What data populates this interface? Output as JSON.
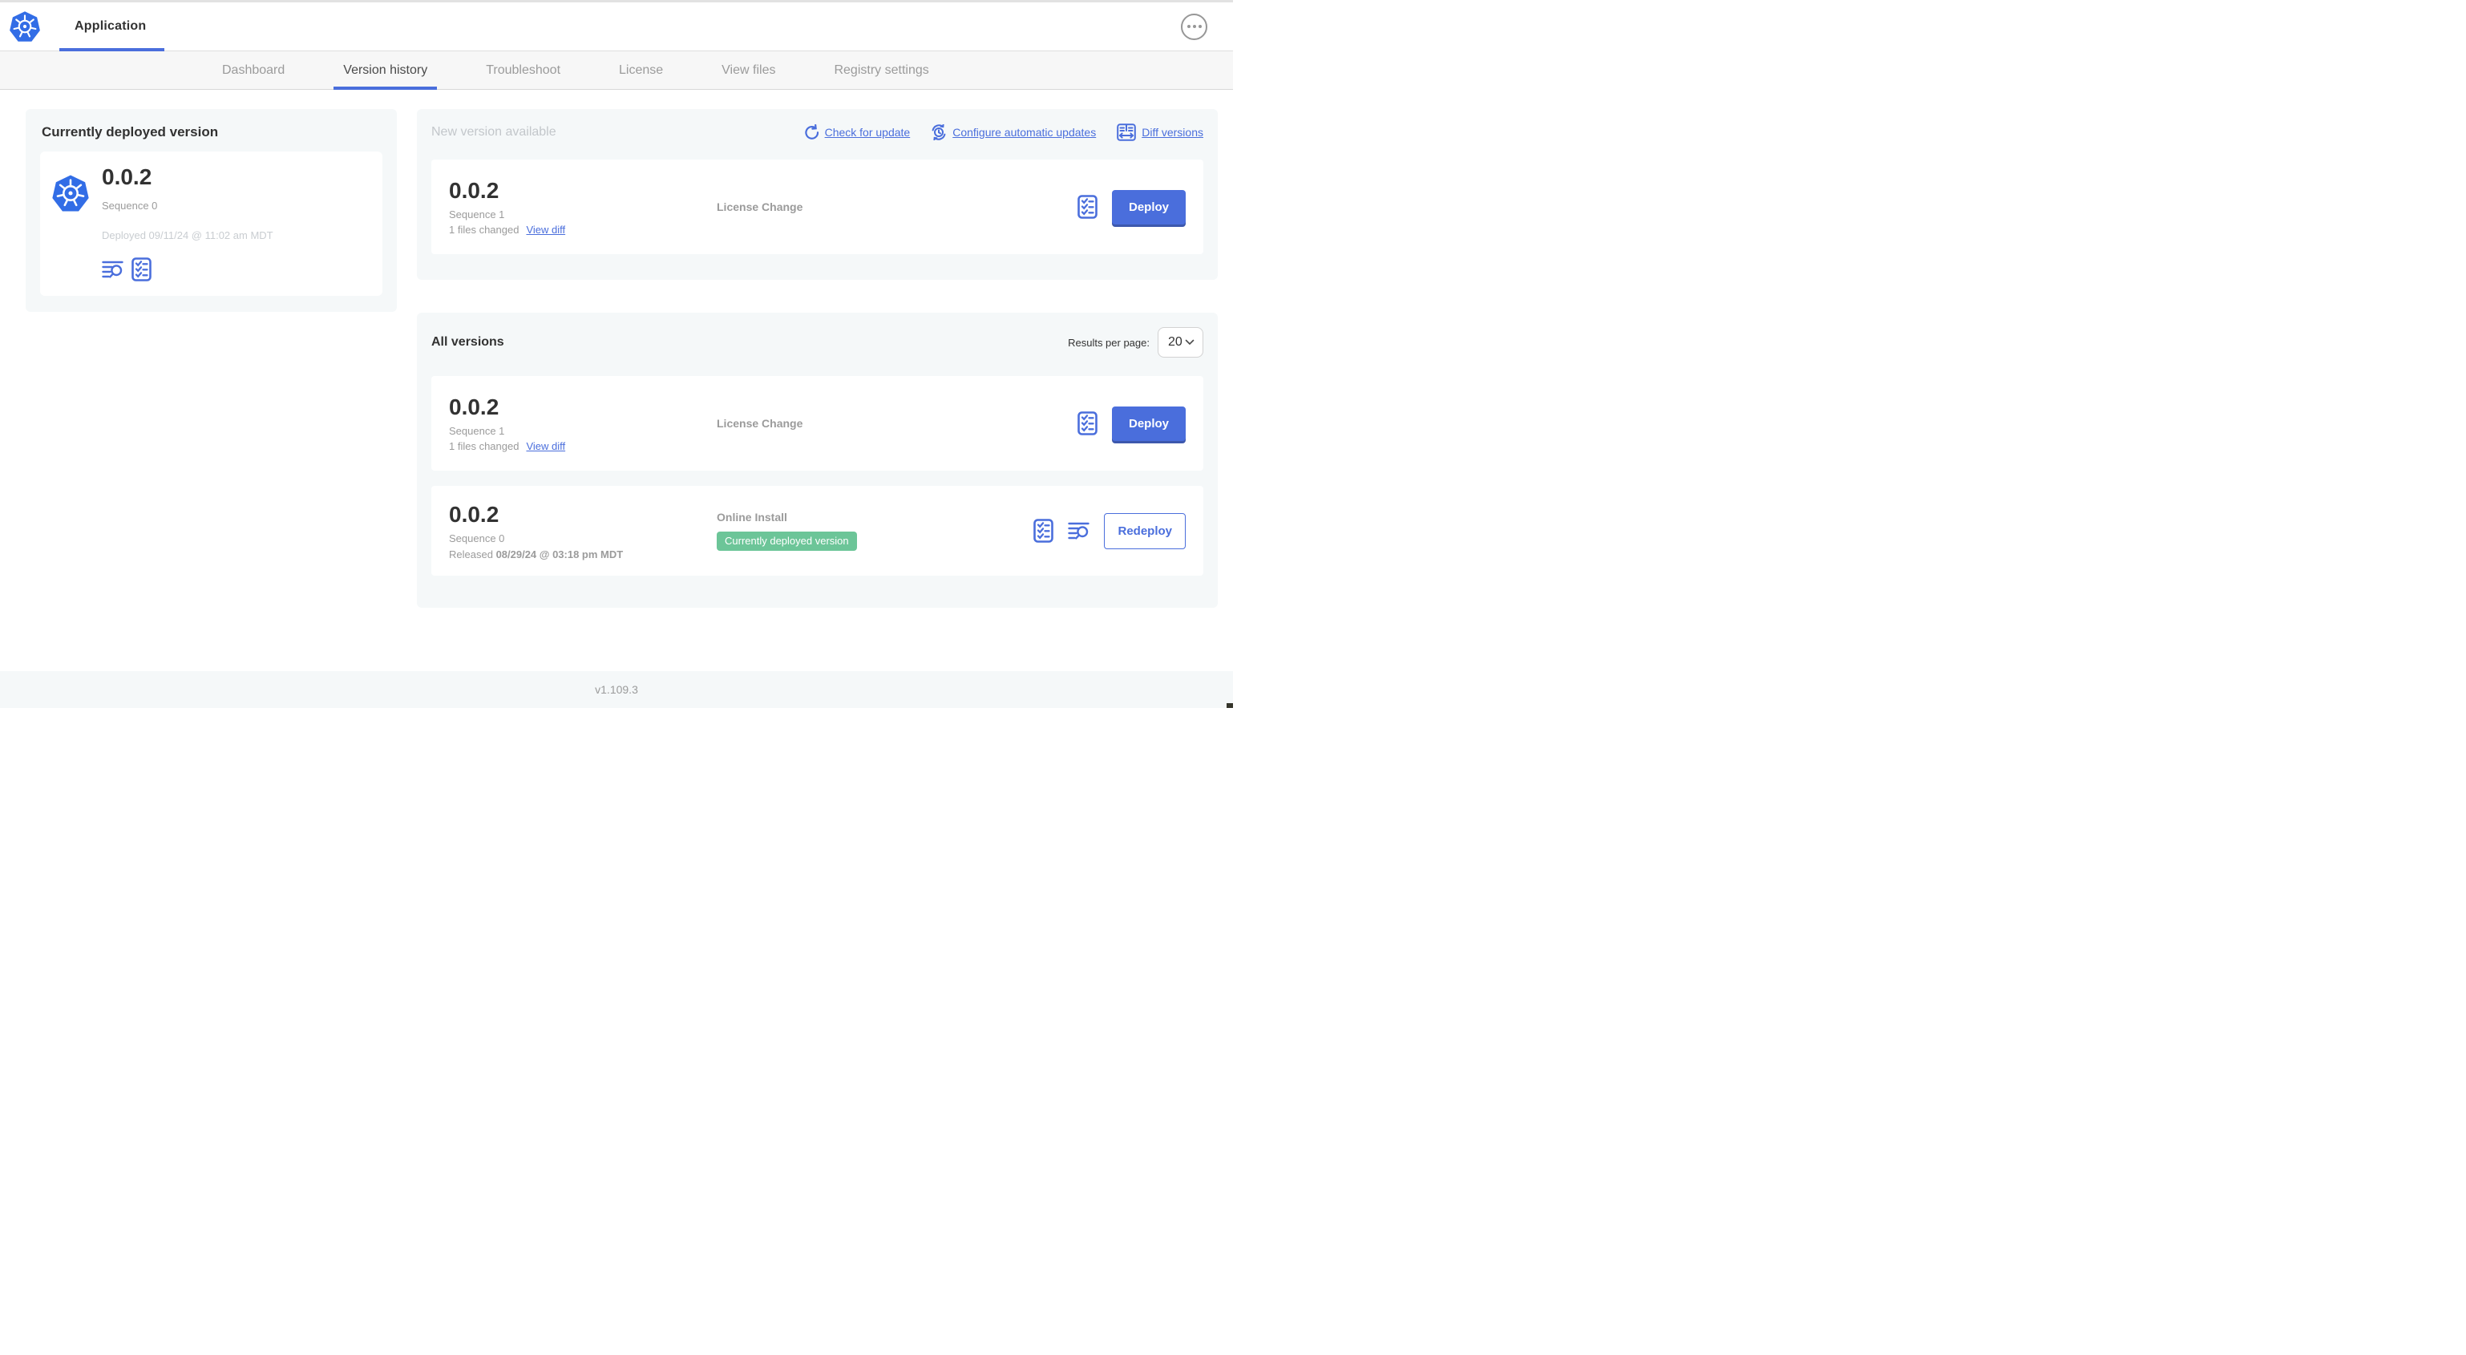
{
  "colors": {
    "primary_blue": "#4a6edc",
    "kubernetes_blue": "#326de6",
    "badge_green": "#6cc598"
  },
  "navbar": {
    "app_title": "Application"
  },
  "tabs": {
    "items": [
      {
        "label": "Dashboard"
      },
      {
        "label": "Version history"
      },
      {
        "label": "Troubleshoot"
      },
      {
        "label": "License"
      },
      {
        "label": "View files"
      },
      {
        "label": "Registry settings"
      }
    ],
    "active": "Version history"
  },
  "current_version_card": {
    "title": "Currently deployed version",
    "version": "0.0.2",
    "sequence": "Sequence 0",
    "deployed_timestamp": "Deployed 09/11/24 @ 11:02 am MDT"
  },
  "new_version_panel": {
    "title": "New version available",
    "actions": [
      {
        "label": "Check for update",
        "icon": "refresh-icon"
      },
      {
        "label": "Configure automatic updates",
        "icon": "auto-update-icon"
      },
      {
        "label": "Diff versions",
        "icon": "diff-icon"
      }
    ],
    "row": {
      "version": "0.0.2",
      "sequence": "Sequence 1",
      "files_changed": "1 files changed",
      "view_diff_label": "View diff",
      "change_type": "License Change",
      "deploy_button": "Deploy"
    }
  },
  "all_versions_panel": {
    "title": "All versions",
    "results_per_page_label": "Results per page:",
    "results_per_page_value": "20",
    "rows": [
      {
        "version": "0.0.2",
        "sequence": "Sequence 1",
        "files_changed": "1 files changed",
        "view_diff_label": "View diff",
        "change_type": "License Change",
        "action_button": "Deploy"
      },
      {
        "version": "0.0.2",
        "sequence": "Sequence 0",
        "released_prefix": "Released",
        "released_date": "08/29/24 @ 03:18 pm MDT",
        "install_type": "Online Install",
        "status_badge": "Currently deployed version",
        "action_button": "Redeploy"
      }
    ]
  },
  "footer": {
    "version": "v1.109.3"
  }
}
